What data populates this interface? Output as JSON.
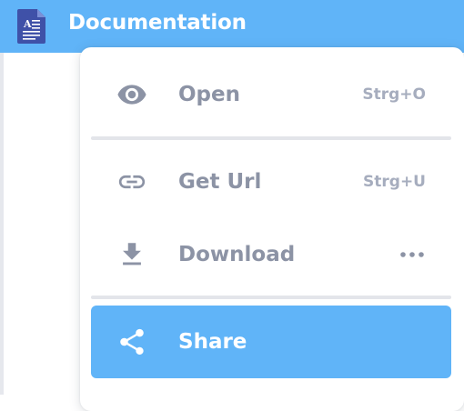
{
  "header": {
    "title": "Documentation",
    "icon": "document-icon",
    "background_color": "#60b4f8"
  },
  "menu": {
    "items": [
      {
        "label": "Open",
        "shortcut": "Strg+O",
        "icon": "eye-icon"
      },
      {
        "label": "Get Url",
        "shortcut": "Strg+U",
        "icon": "link-icon"
      },
      {
        "label": "Download",
        "shortcut": "",
        "icon": "download-icon",
        "trailing_icon": "more-horizontal-icon"
      },
      {
        "label": "Share",
        "shortcut": "",
        "icon": "share-icon",
        "active": true
      }
    ],
    "text_color": "#8c93a5",
    "highlight_color": "#60b4f8"
  }
}
